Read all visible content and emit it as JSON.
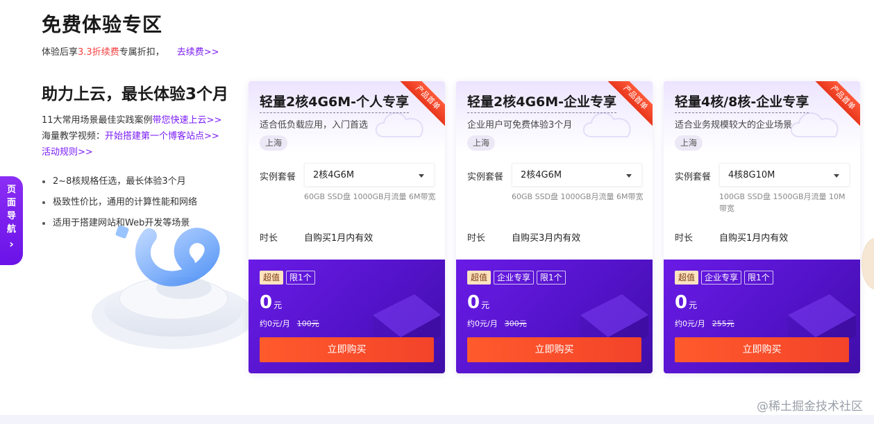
{
  "header": {
    "title": "免费体验专区",
    "subtitle_pre": "体验后享",
    "subtitle_highlight": "3.3折续费",
    "subtitle_post": "专属折扣，",
    "subtitle_link": "去续费>>"
  },
  "promo": {
    "heading": "助力上云，最长体验3个月",
    "line1_text": "11大常用场景最佳实践案例",
    "line1_link": "带您快速上云>>",
    "line2_text": "海量教学视频：",
    "line2_link": "开始搭建第一个博客站点>>",
    "rules_link": "活动规则>>",
    "bullets": [
      "2~8核规格任选，最长体验3个月",
      "极致性价比，通用的计算性能和网络",
      "适用于搭建网站和Web开发等场景"
    ]
  },
  "side_nav": {
    "chars": [
      "页",
      "面",
      "导",
      "航"
    ],
    "arrow": "›"
  },
  "labels": {
    "package": "实例套餐",
    "duration": "时长",
    "per_month_prefix": "约0元/月",
    "currency_unit": "元",
    "buy": "立即购买"
  },
  "cards": [
    {
      "ribbon": "产品首单",
      "title": "轻量2核4G6M-个人专享",
      "desc": "适合低负载应用，入门首选",
      "region": "上海",
      "selected_package": "2核4G6M",
      "spec": "60GB SSD盘 1000GB月流量 6M带宽",
      "duration": "自购买1月内有效",
      "tags": [
        "超值",
        "限1个"
      ],
      "price": "0",
      "original_price": "100元"
    },
    {
      "ribbon": "产品首单",
      "title": "轻量2核4G6M-企业专享",
      "desc": "企业用户可免费体验3个月",
      "region": "上海",
      "selected_package": "2核4G6M",
      "spec": "60GB SSD盘 1000GB月流量 6M带宽",
      "duration": "自购买3月内有效",
      "tags": [
        "超值",
        "企业专享",
        "限1个"
      ],
      "price": "0",
      "original_price": "300元"
    },
    {
      "ribbon": "产品首单",
      "title": "轻量4核/8核-企业专享",
      "desc": "适合业务规模较大的企业场景",
      "region": "上海",
      "selected_package": "4核8G10M",
      "spec": "100GB SSD盘 1500GB月流量 10M带宽",
      "duration": "自购买1月内有效",
      "tags": [
        "超值",
        "企业专享",
        "限1个"
      ],
      "price": "0",
      "original_price": "255元"
    }
  ],
  "watermark": "@稀土掘金技术社区",
  "colors": {
    "accent_purple": "#7a1bf5",
    "highlight_red": "#f53f3f",
    "buy_orange": "#f3432a",
    "card_purple": "#5313c9"
  }
}
